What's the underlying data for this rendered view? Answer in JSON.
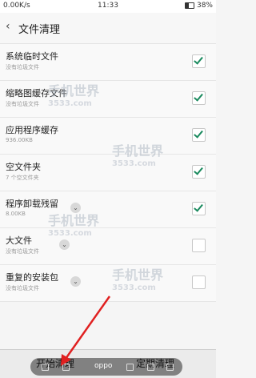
{
  "status_bar": {
    "speed": "0.00K/s",
    "time": "11:33",
    "battery": "38%"
  },
  "header": {
    "back_glyph": "‹",
    "title": "文件清理"
  },
  "items": [
    {
      "label": "系统临时文件",
      "sub": "没有垃圾文件",
      "checked": true,
      "expand": false
    },
    {
      "label": "缩略图缓存文件",
      "sub": "没有垃圾文件",
      "checked": true,
      "expand": false
    },
    {
      "label": "应用程序缓存",
      "sub": "936.00KB",
      "checked": true,
      "expand": false
    },
    {
      "label": "空文件夹",
      "sub": "7 个空文件夹",
      "checked": true,
      "expand": false
    },
    {
      "label": "程序卸载残留",
      "sub": "8.00KB",
      "checked": true,
      "expand": true
    },
    {
      "label": "大文件",
      "sub": "没有垃圾文件",
      "checked": false,
      "expand": true
    },
    {
      "label": "重复的安装包",
      "sub": "没有垃圾文件",
      "checked": false,
      "expand": true
    }
  ],
  "bottom_bar": {
    "start_label": "开始清理",
    "scheduled_label": "定期清理"
  },
  "overlay": {
    "brand": "oppo"
  },
  "watermarks": [
    {
      "text": "手机世界",
      "sub": "3533.com"
    },
    {
      "text": "手机世界",
      "sub": "3533.com"
    },
    {
      "text": "手机世界",
      "sub": "3533.com"
    },
    {
      "text": "手机世界",
      "sub": "3533.com"
    }
  ],
  "colors": {
    "check": "#1a8a5e",
    "arrow": "#e02020"
  }
}
